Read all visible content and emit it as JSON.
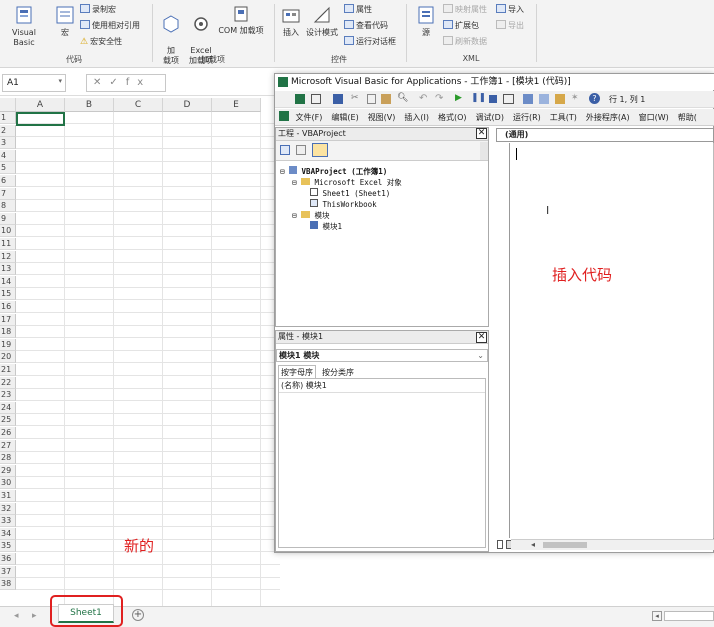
{
  "ribbon": {
    "code_group": {
      "label": "代码",
      "visual_basic": "Visual Basic",
      "macros": "宏",
      "record_macro": "录制宏",
      "relative_ref": "使用相对引用",
      "macro_security": "宏安全性"
    },
    "addins_group": {
      "label": "加载项",
      "addins": "加\n载项",
      "excel_addins": "Excel\n加载项",
      "com_addins": "COM 加载项"
    },
    "controls_group": {
      "label": "控件",
      "insert": "插入",
      "design_mode": "设计模式",
      "properties": "属性",
      "view_code": "查看代码",
      "run_dialog": "运行对话框"
    },
    "xml_group": {
      "label": "XML",
      "source": "源",
      "map_properties": "映射属性",
      "expansion_packs": "扩展包",
      "refresh_data": "刷新数据",
      "import": "导入",
      "export": "导出"
    }
  },
  "formula_bar": {
    "name_box": "A1",
    "fx_symbols": "✕✓fx"
  },
  "grid": {
    "columns": [
      "A",
      "B",
      "C",
      "D",
      "E"
    ],
    "rows": [
      "1",
      "2",
      "3",
      "4",
      "5",
      "6",
      "7",
      "8",
      "9",
      "10",
      "11",
      "12",
      "13",
      "14",
      "15",
      "16",
      "17",
      "18",
      "19",
      "20",
      "21",
      "22",
      "23",
      "24",
      "25",
      "26",
      "27",
      "28",
      "29",
      "30",
      "31",
      "32",
      "33",
      "34",
      "35",
      "36",
      "37",
      "38"
    ]
  },
  "sheet_tabs": {
    "active": "Sheet1"
  },
  "annotations": {
    "new_label": "新的",
    "insert_code": "插入代码"
  },
  "vbe": {
    "title": "Microsoft Visual Basic for Applications - 工作簿1 - [模块1 (代码)]",
    "cursor_pos": "行 1, 列 1",
    "menu": [
      "文件(F)",
      "编辑(E)",
      "视图(V)",
      "插入(I)",
      "格式(O)",
      "调试(D)",
      "运行(R)",
      "工具(T)",
      "外接程序(A)",
      "窗口(W)",
      "帮助("
    ],
    "project_panel": {
      "title": "工程 - VBAProject",
      "root": "VBAProject (工作簿1)",
      "folder_objects": "Microsoft Excel 对象",
      "sheet1": "Sheet1 (Sheet1)",
      "thisworkbook": "ThisWorkbook",
      "folder_modules": "模块",
      "module1": "模块1"
    },
    "properties_panel": {
      "title": "属性 - 模块1",
      "object": "模块1 模块",
      "tab_alpha": "按字母序",
      "tab_category": "按分类序",
      "row_name": "(名称) 模块1"
    },
    "code_window": {
      "object_dropdown": "(通用)"
    }
  },
  "colors": {
    "accent_green": "#217346",
    "annotation_red": "#e02020"
  }
}
